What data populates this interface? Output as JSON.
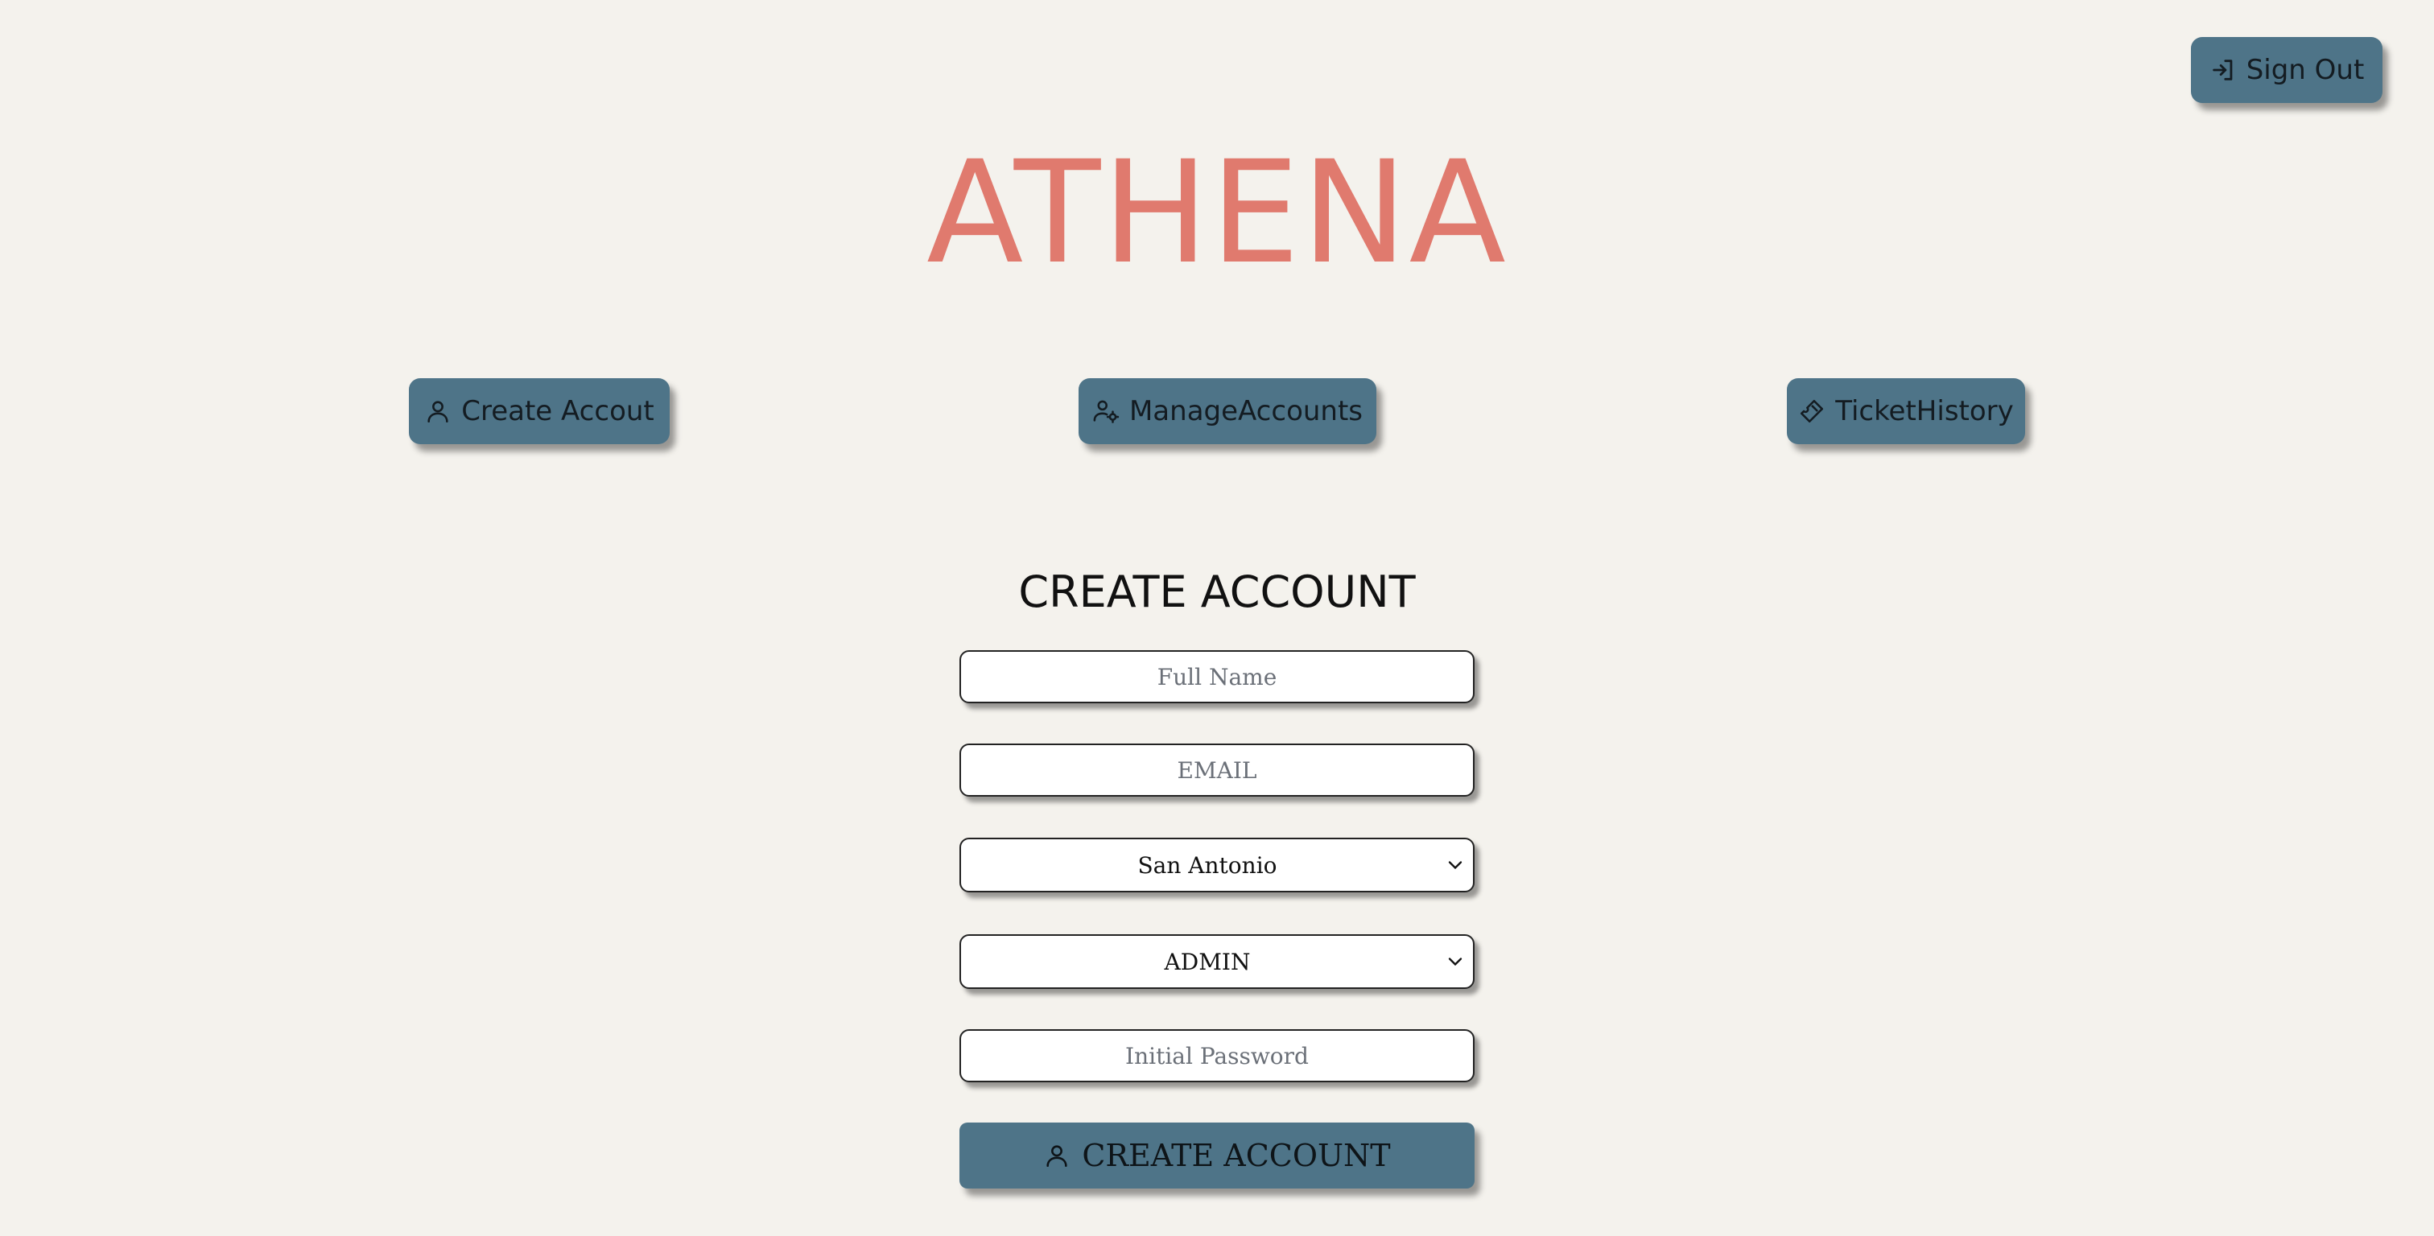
{
  "header": {
    "sign_out_label": "Sign Out",
    "sign_out_icon": "sign-out-icon",
    "logo_text": "ATHENA"
  },
  "nav": {
    "create": {
      "label": "Create Accout",
      "icon": "user-icon"
    },
    "manage": {
      "label": "ManageAccounts",
      "icon": "users-gear-icon"
    },
    "tickets": {
      "label": "TicketHistory",
      "icon": "ticket-icon"
    }
  },
  "form": {
    "title": "CREATE ACCOUNT",
    "full_name_placeholder": "Full Name",
    "email_placeholder": "EMAIL",
    "city_value": "San Antonio",
    "role_value": "ADMIN",
    "password_placeholder": "Initial Password",
    "submit_label": "CREATE ACCOUNT"
  },
  "colors": {
    "background": "#f4f2ed",
    "button": "#4e7488",
    "logo": "#e07a6e"
  }
}
